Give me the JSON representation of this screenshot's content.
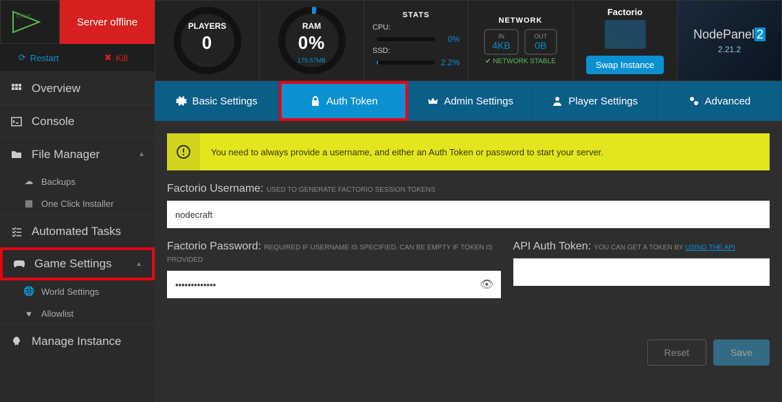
{
  "server": {
    "status": "Server offline",
    "startLabel": "START",
    "restart": "Restart",
    "kill": "Kill"
  },
  "gauges": {
    "players": {
      "label": "PLAYERS",
      "value": "0"
    },
    "ram": {
      "label": "RAM",
      "value": "0%",
      "sub": "179.57MB"
    }
  },
  "stats": {
    "title": "STATS",
    "cpu": {
      "label": "CPU:",
      "value": "0%"
    },
    "ssd": {
      "label": "SSD:",
      "value": "2.2%"
    }
  },
  "network": {
    "title": "NETWORK",
    "in": {
      "label": "IN",
      "value": "4KB"
    },
    "out": {
      "label": "OUT",
      "value": "0B"
    },
    "status": "NETWORK STABLE"
  },
  "game": {
    "name": "Factorio",
    "swap": "Swap Instance"
  },
  "brand": {
    "name": "NodePanel",
    "suffix": "2",
    "version": "2.21.2"
  },
  "sidebar": {
    "overview": "Overview",
    "console": "Console",
    "fileManager": "File Manager",
    "backups": "Backups",
    "oneClick": "One Click Installer",
    "automated": "Automated Tasks",
    "gameSettings": "Game Settings",
    "worldSettings": "World Settings",
    "allowlist": "Allowlist",
    "manage": "Manage Instance"
  },
  "tabs": {
    "basic": "Basic Settings",
    "auth": "Auth Token",
    "admin": "Admin Settings",
    "player": "Player Settings",
    "advanced": "Advanced"
  },
  "alert": {
    "text": "You need to always provide a username, and either an Auth Token or password to start your server."
  },
  "form": {
    "username": {
      "label": "Factorio Username:",
      "hint": "USED TO GENERATE FACTORIO SESSION TOKENS",
      "value": "nodecraft"
    },
    "password": {
      "label": "Factorio Password:",
      "hint": "REQUIRED IF USERNAME IS SPECIFIED. CAN BE EMPTY IF TOKEN IS PROVIDED",
      "value": "•••••••••••••"
    },
    "token": {
      "label": "API Auth Token:",
      "hint": "YOU CAN GET A TOKEN BY ",
      "link": "USING THE API"
    },
    "reset": "Reset",
    "save": "Save"
  }
}
